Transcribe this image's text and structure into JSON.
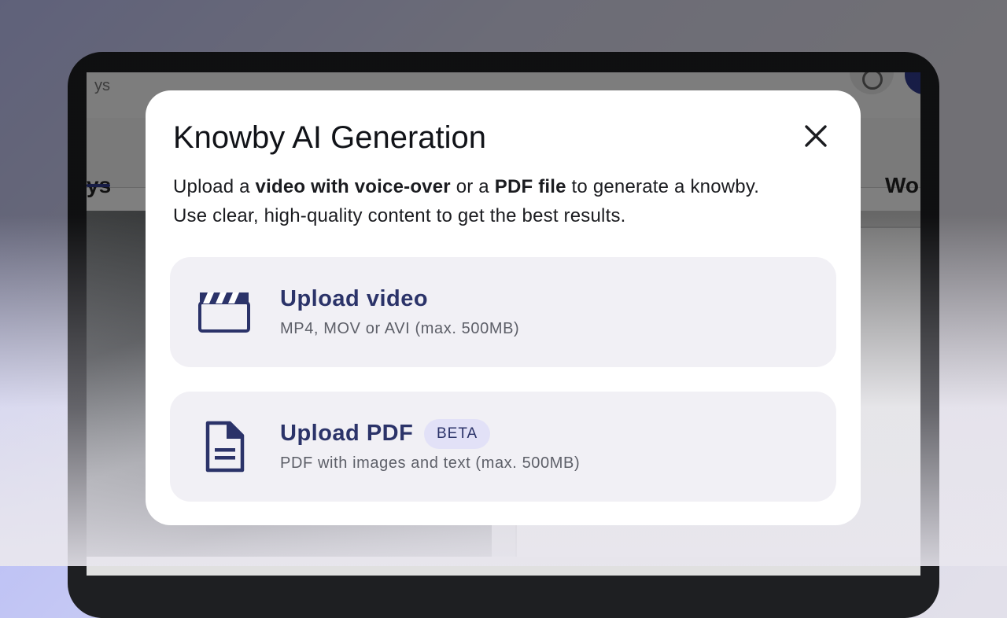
{
  "background_app": {
    "search_partial": "ys",
    "tab_left_partial": "ys",
    "tab_right_partial": "Wo"
  },
  "modal": {
    "title": "Knowby AI Generation",
    "close_icon": "close-icon",
    "description": {
      "line1_prefix": "Upload a ",
      "line1_bold1": "video with voice-over",
      "line1_mid": " or a ",
      "line1_bold2": "PDF file",
      "line1_suffix": " to generate a knowby.",
      "line2": "Use clear, high-quality content to get the best results."
    },
    "options": [
      {
        "icon": "clapperboard-icon",
        "title": "Upload video",
        "subtitle": "MP4, MOV or AVI (max. 500MB)"
      },
      {
        "icon": "document-icon",
        "title": "Upload PDF",
        "badge": "BETA",
        "subtitle": "PDF with images and text (max. 500MB)"
      }
    ]
  },
  "colors": {
    "accent": "#2b3369",
    "option_bg": "#f1f0f5",
    "badge_bg": "#e2e1f7"
  }
}
